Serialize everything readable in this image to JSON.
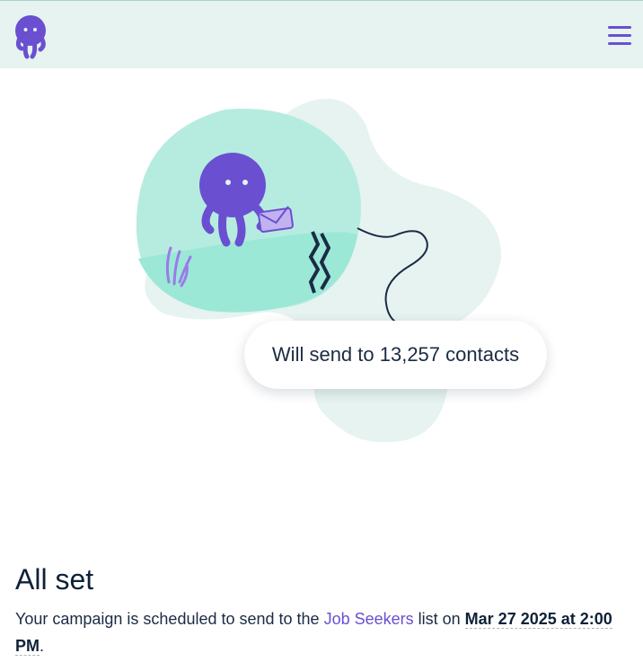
{
  "header": {
    "logo_icon": "octopus-logo-icon",
    "menu_icon": "hamburger-menu-icon",
    "accent": "#6a4fd1",
    "background": "#e6f3f0"
  },
  "illustration": {
    "send_label": "Will send to 13,257 contacts"
  },
  "confirmation": {
    "title": "All set",
    "text_before": "Your campaign is scheduled to send to the ",
    "list_name": "Job Seekers",
    "text_middle": " list on ",
    "schedule": "Mar 27 2025 at 2:00 PM",
    "text_after": "."
  }
}
